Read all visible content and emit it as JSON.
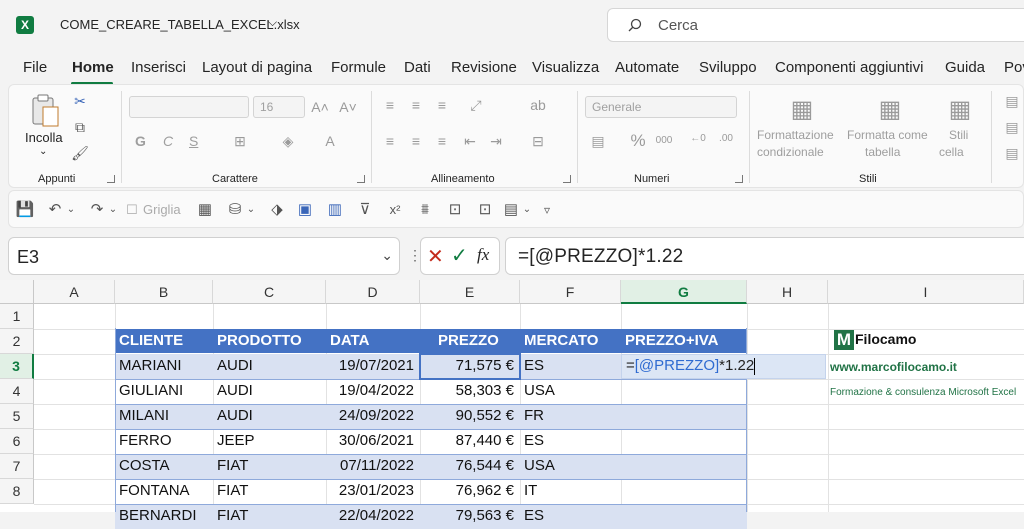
{
  "titlebar": {
    "app_icon": "X",
    "filename": "COME_CREARE_TABELLA_EXCEL.xlsx",
    "search_placeholder": "Cerca"
  },
  "menu": [
    "File",
    "Home",
    "Inserisci",
    "Layout di pagina",
    "Formule",
    "Dati",
    "Revisione",
    "Visualizza",
    "Automate",
    "Sviluppo",
    "Componenti aggiuntivi",
    "Guida",
    "Pov"
  ],
  "ribbon": {
    "clipboard": {
      "paste_label": "Incolla",
      "group_label": "Appunti"
    },
    "font": {
      "font_name": "",
      "font_size": "16",
      "group_label": "Carattere",
      "bold": "G",
      "italic": "C",
      "underline": "S"
    },
    "alignment": {
      "group_label": "Allineamento"
    },
    "number": {
      "format": "Generale",
      "group_label": "Numeri"
    },
    "styles": {
      "cond_format_l1": "Formattazione",
      "cond_format_l2": "condizionale",
      "format_table_l1": "Formatta come",
      "format_table_l2": "tabella",
      "cell_styles_l1": "Stili",
      "cell_styles_l2": "cella",
      "group_label": "Stili"
    }
  },
  "qat": {
    "gridlines_label": "Griglia"
  },
  "formula_bar": {
    "name_box": "E3",
    "fx_label": "fx",
    "formula": "=[@PREZZO]*1.22"
  },
  "columns": [
    "A",
    "B",
    "C",
    "D",
    "E",
    "F",
    "G",
    "H",
    "I"
  ],
  "rows": [
    "1",
    "2",
    "3",
    "4",
    "5",
    "6",
    "7",
    "8"
  ],
  "table": {
    "headers": [
      "CLIENTE",
      "PRODOTTO",
      "DATA",
      "PREZZO",
      "MERCATO",
      "PREZZO+IVA"
    ],
    "rows": [
      [
        "MARIANI",
        "AUDI",
        "19/07/2021",
        "71,575 €",
        "ES"
      ],
      [
        "GIULIANI",
        "AUDI",
        "19/04/2022",
        "58,303 €",
        "USA"
      ],
      [
        "MILANI",
        "AUDI",
        "24/09/2022",
        "90,552 €",
        "FR"
      ],
      [
        "FERRO",
        "JEEP",
        "30/06/2021",
        "87,440 €",
        "ES"
      ],
      [
        "COSTA",
        "FIAT",
        "07/11/2022",
        "76,544 €",
        "USA"
      ],
      [
        "FONTANA",
        "FIAT",
        "23/01/2023",
        "76,962 €",
        "IT"
      ],
      [
        "BERNARDI",
        "FIAT",
        "22/04/2022",
        "79,563 €",
        "ES"
      ]
    ],
    "editing": {
      "eq": "=",
      "ref": "[@PREZZO]",
      "rest": "*1.22"
    }
  },
  "logo": {
    "m": "M",
    "name": "Filocamo",
    "url": "www.marcofilocamo.it",
    "tagline": "Formazione & consulenza Microsoft Excel"
  },
  "colors": {
    "accent": "#107c41",
    "table_header": "#4472c4",
    "band": "#d9e1f2"
  }
}
